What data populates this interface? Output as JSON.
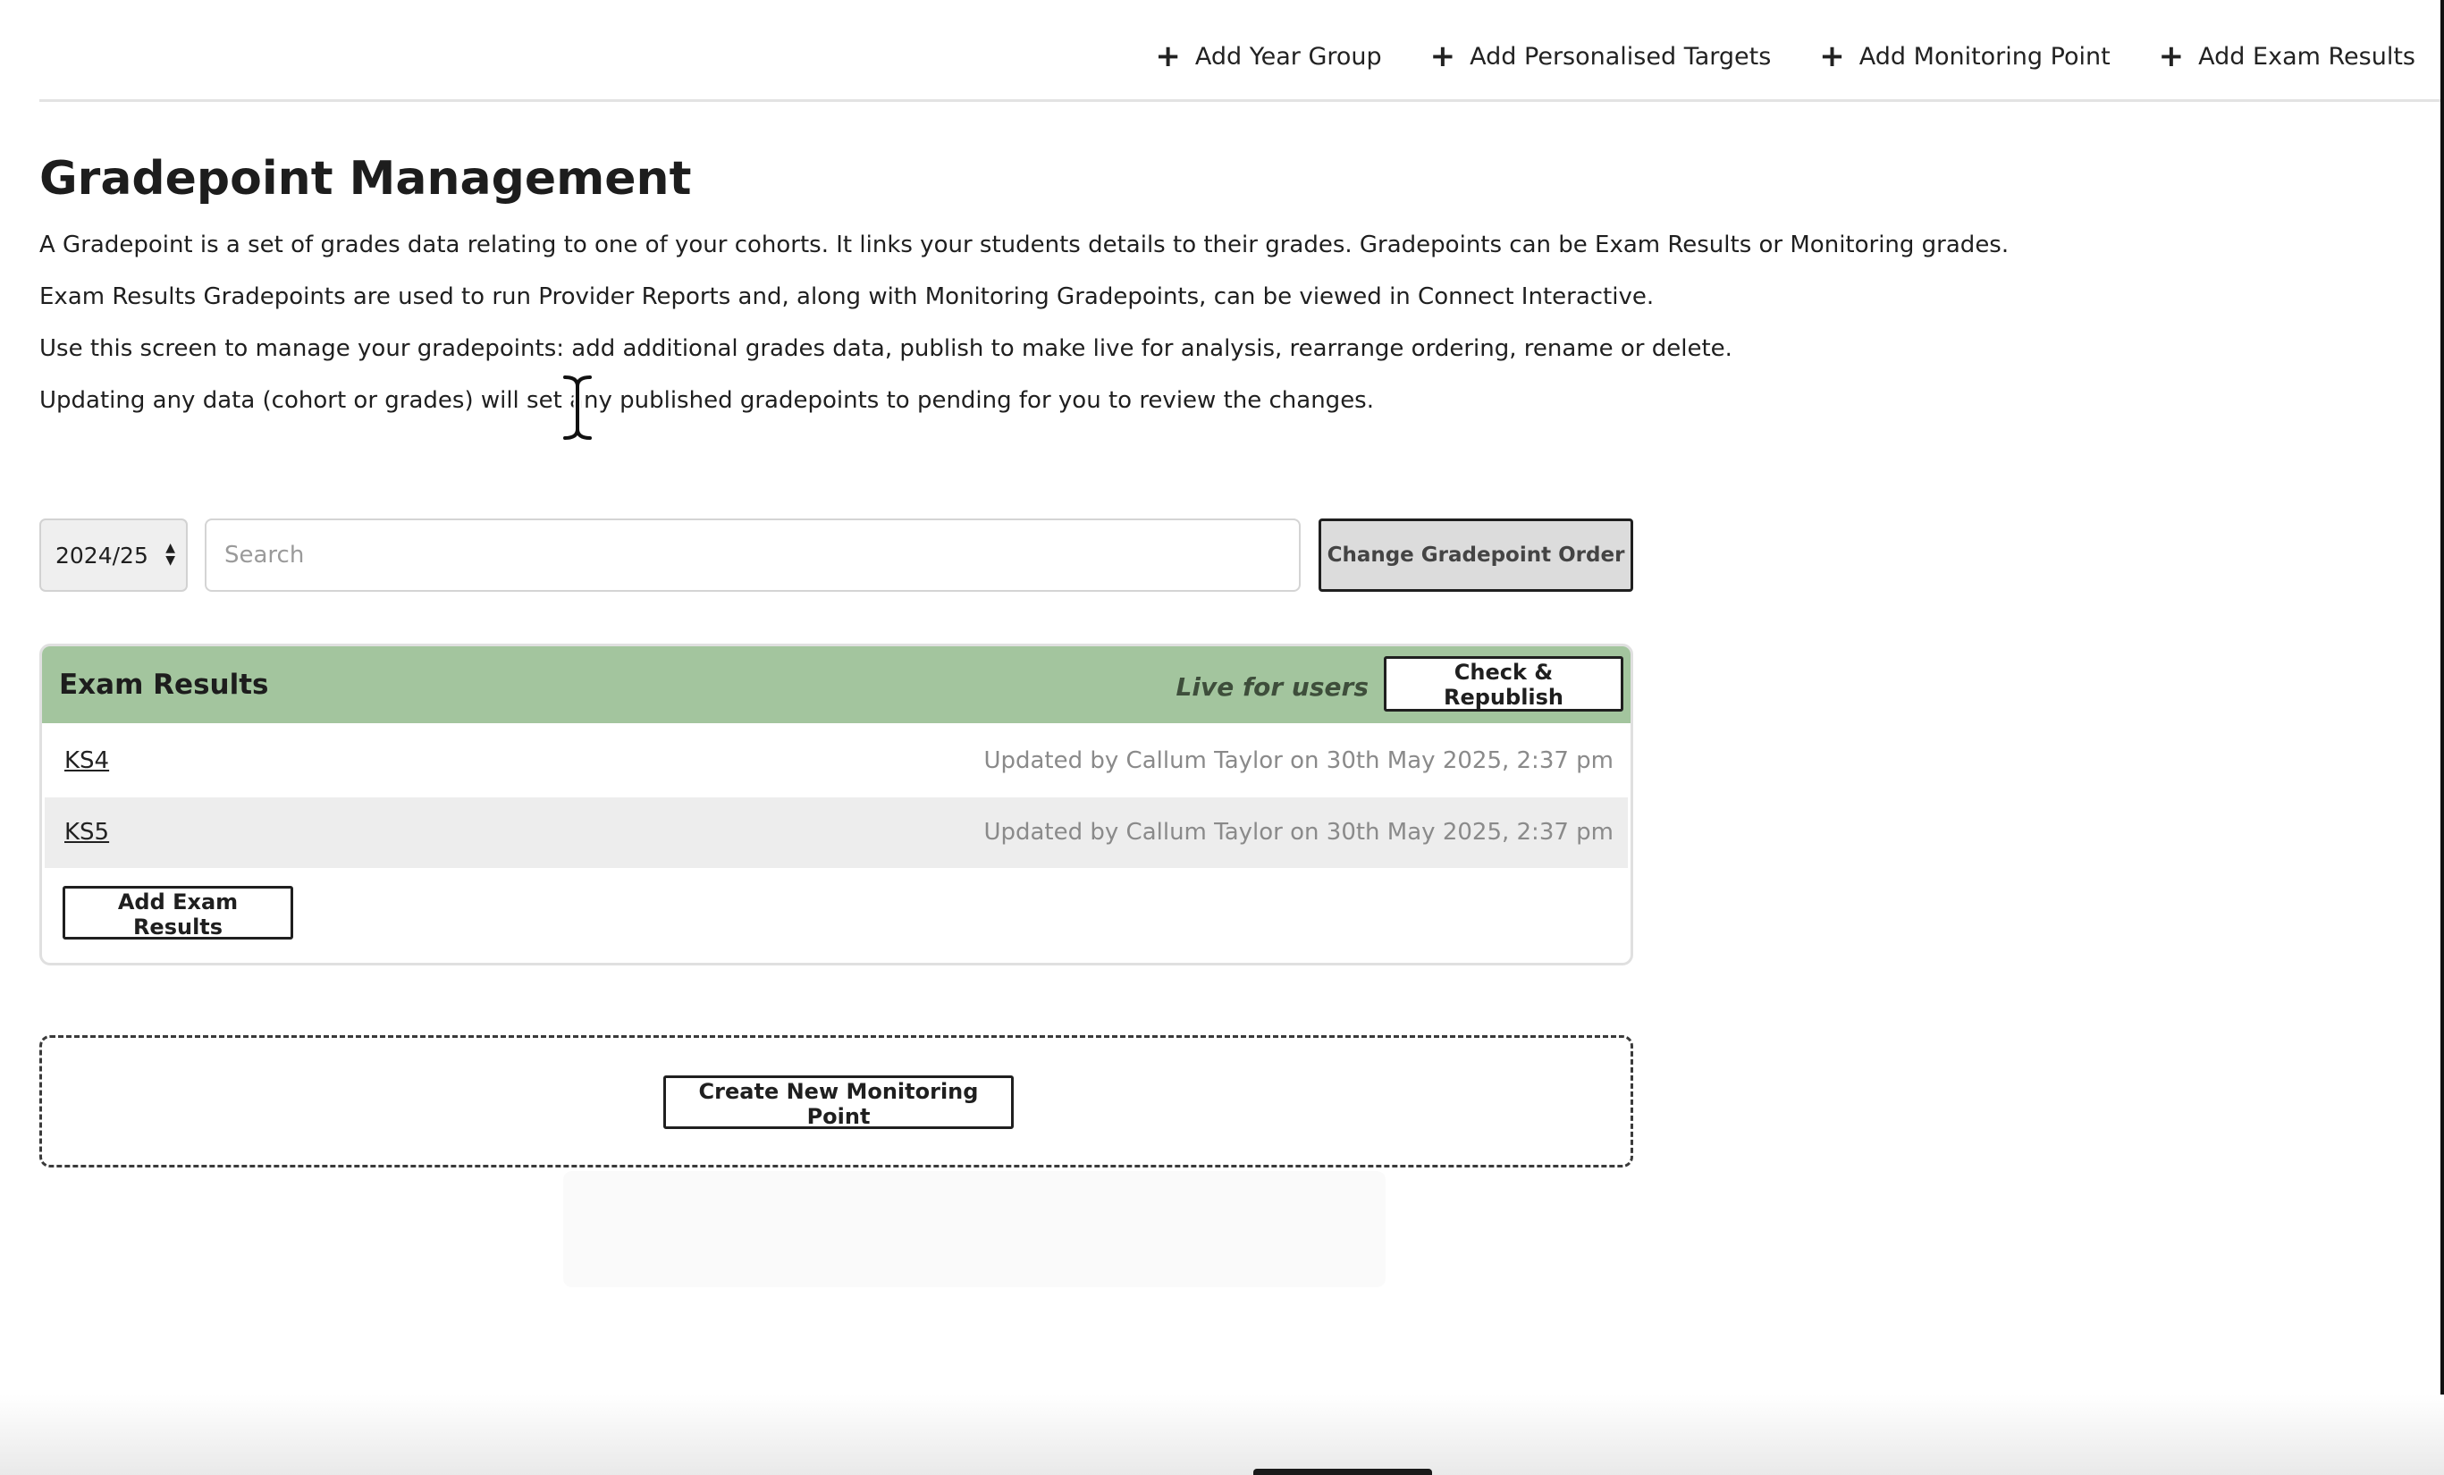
{
  "topnav": {
    "items": [
      {
        "label": "Add Year Group",
        "icon": "plus-icon"
      },
      {
        "label": "Add Personalised Targets",
        "icon": "plus-icon"
      },
      {
        "label": "Add Monitoring Point",
        "icon": "plus-icon"
      },
      {
        "label": "Add Exam Results",
        "icon": "plus-icon"
      }
    ]
  },
  "page": {
    "title": "Gradepoint Management",
    "intro": [
      "A Gradepoint is a set of grades data relating to one of your cohorts. It links your students details to their grades. Gradepoints can be Exam Results or Monitoring grades.",
      "Exam Results Gradepoints are used to run Provider Reports and, along with Monitoring Gradepoints, can be viewed in Connect Interactive.",
      "Use this screen to manage your gradepoints: add additional grades data, publish to make live for analysis, rearrange ordering, rename or delete.",
      "Updating any data (cohort or grades) will set any published gradepoints to pending for you to review the changes."
    ]
  },
  "controls": {
    "year_selected": "2024/25",
    "search_placeholder": "Search",
    "search_value": "",
    "order_button_label": "Change Gradepoint Order"
  },
  "exam_panel": {
    "title": "Exam Results",
    "status": "Live for users",
    "status_color": "#a3c59e",
    "republish_label": "Check & Republish",
    "rows": [
      {
        "name": "KS4",
        "meta": "Updated by Callum Taylor on 30th May 2025, 2:37 pm"
      },
      {
        "name": "KS5",
        "meta": "Updated by Callum Taylor on 30th May 2025, 2:37 pm"
      }
    ],
    "add_button_label": "Add Exam Results"
  },
  "monitoring": {
    "create_button_label": "Create New Monitoring Point"
  }
}
